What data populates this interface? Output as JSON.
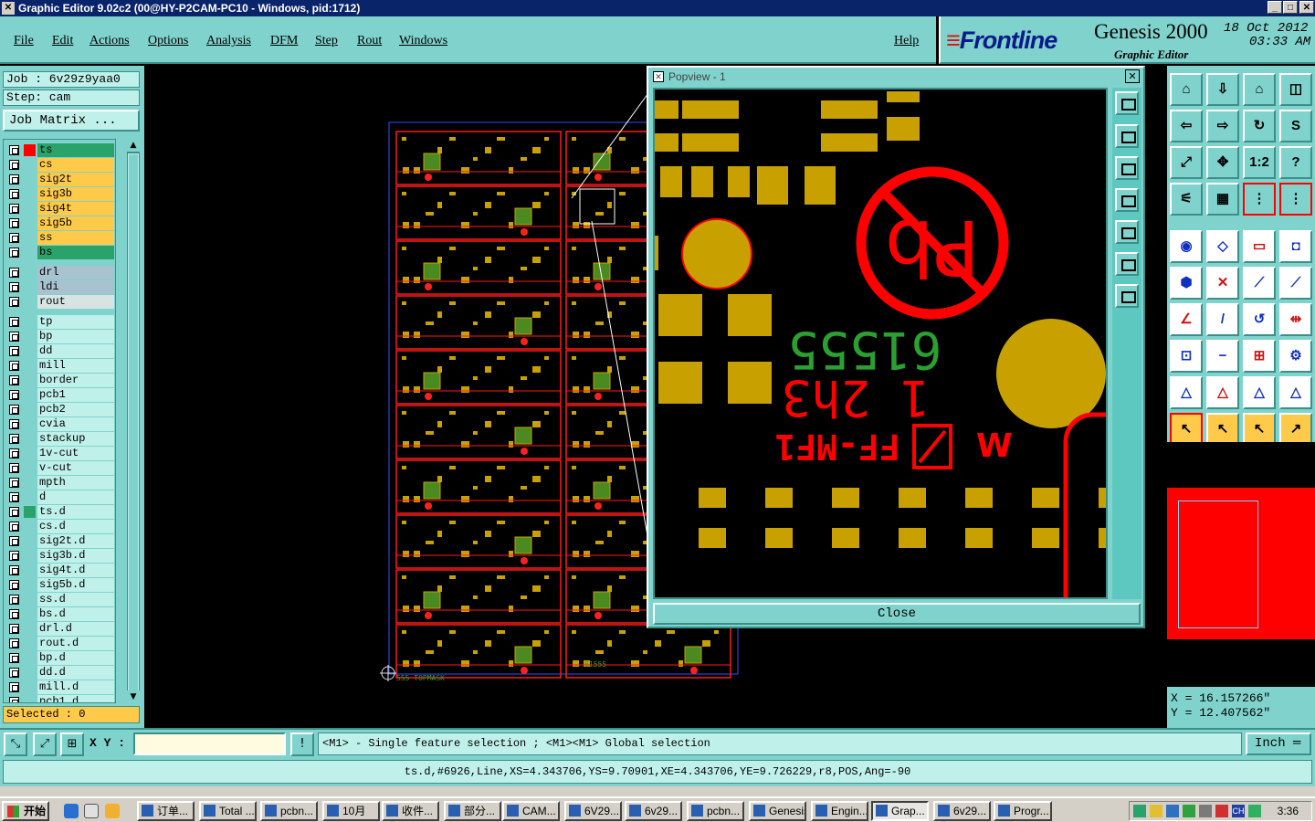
{
  "window": {
    "title": "Graphic Editor 9.02c2 (00@HY-P2CAM-PC10 - Windows, pid:1712)",
    "min": "_",
    "max": "□",
    "close": "✕"
  },
  "menu": [
    "File",
    "Edit",
    "Actions",
    "Options",
    "Analysis",
    "DFM",
    "Step",
    "Rout",
    "Windows"
  ],
  "help": "Help",
  "brand": {
    "logo": "Frontline",
    "product": "Genesis 2000",
    "subtitle": "Graphic Editor",
    "date": "18 Oct 2012",
    "time": "03:33 AM"
  },
  "job": {
    "job_line": "Job : 6v29z9yaa0",
    "step_line": "Step: cam",
    "matrix_button": "Job Matrix ..."
  },
  "layers": [
    {
      "name": "ts",
      "color": "#2aa36a",
      "marker": "#ff0000"
    },
    {
      "name": "cs",
      "color": "#ffc94a"
    },
    {
      "name": "sig2t",
      "color": "#ffc94a"
    },
    {
      "name": "sig3b",
      "color": "#ffc94a"
    },
    {
      "name": "sig4t",
      "color": "#ffc94a"
    },
    {
      "name": "sig5b",
      "color": "#ffc94a"
    },
    {
      "name": "ss",
      "color": "#ffc94a"
    },
    {
      "name": "bs",
      "color": "#2aa36a"
    },
    {
      "name": "drl",
      "color": "#a9c2cf"
    },
    {
      "name": "ldi",
      "color": "#a9c2cf"
    },
    {
      "name": "rout",
      "color": "#d8e4e4"
    },
    {
      "name": "tp",
      "color": "#bff0ea"
    },
    {
      "name": "bp",
      "color": "#bff0ea"
    },
    {
      "name": "dd",
      "color": "#bff0ea"
    },
    {
      "name": "mill",
      "color": "#bff0ea"
    },
    {
      "name": "border",
      "color": "#bff0ea"
    },
    {
      "name": "pcb1",
      "color": "#bff0ea"
    },
    {
      "name": "pcb2",
      "color": "#bff0ea"
    },
    {
      "name": "cvia",
      "color": "#bff0ea"
    },
    {
      "name": "stackup",
      "color": "#bff0ea"
    },
    {
      "name": "1v-cut",
      "color": "#bff0ea"
    },
    {
      "name": "v-cut",
      "color": "#bff0ea"
    },
    {
      "name": "mpth",
      "color": "#bff0ea"
    },
    {
      "name": "d",
      "color": "#bff0ea"
    },
    {
      "name": "ts.d",
      "color": "#bff0ea",
      "marker": "#2aa36a"
    },
    {
      "name": "cs.d",
      "color": "#bff0ea"
    },
    {
      "name": "sig2t.d",
      "color": "#bff0ea"
    },
    {
      "name": "sig3b.d",
      "color": "#bff0ea"
    },
    {
      "name": "sig4t.d",
      "color": "#bff0ea"
    },
    {
      "name": "sig5b.d",
      "color": "#bff0ea"
    },
    {
      "name": "ss.d",
      "color": "#bff0ea"
    },
    {
      "name": "bs.d",
      "color": "#bff0ea"
    },
    {
      "name": "drl.d",
      "color": "#bff0ea"
    },
    {
      "name": "rout.d",
      "color": "#bff0ea"
    },
    {
      "name": "bp.d",
      "color": "#bff0ea"
    },
    {
      "name": "dd.d",
      "color": "#bff0ea"
    },
    {
      "name": "mill.d",
      "color": "#bff0ea"
    },
    {
      "name": "pcb1.d",
      "color": "#bff0ea"
    }
  ],
  "selected": "Selected : 0",
  "canvas": {
    "board_label": "61555",
    "bottom_label": "555  TOPMASK"
  },
  "popview": {
    "title": "Popview - 1",
    "close_label": "Close",
    "close_x": "✕",
    "texts": {
      "green_number": "61555",
      "red_number": "1 2h3",
      "red_marking": "FF-MF1",
      "pb_symbol": "Pb"
    }
  },
  "coords": {
    "x": "X = 16.157266\"",
    "y": "Y = 12.407562\""
  },
  "command": {
    "xy_label": "X Y :",
    "xy_value": "",
    "hint": "<M1> - Single feature selection ; <M1><M1> Global selection",
    "unit": "Inch"
  },
  "info": "ts.d,#6926,Line,XS=4.343706,YS=9.70901,XE=4.343706,YE=9.726229,r8,POS,Ang=-90",
  "taskbar": {
    "start": "开始",
    "tasks": [
      "订单...",
      "Total ...",
      "pcbn...",
      "10月",
      "收件...",
      "部分...",
      "CAM...",
      "6V29...",
      "6v29...",
      "pcbn...",
      "Genesis",
      "Engin...",
      "Grap...",
      "6v29...",
      "Progr..."
    ],
    "clock": "3:36",
    "lang": "CH"
  },
  "colors": {
    "panel": "#7fd3cc",
    "panel_light": "#bff0ea",
    "copper": "#c8a000",
    "mask_red": "#ff0000",
    "silk_green": "#2aa030"
  },
  "icons": {
    "right_tools": [
      "view-home-icon",
      "view-down-icon",
      "house-icon",
      "window-split-icon",
      "view-left-icon",
      "view-right-icon",
      "swap-icon",
      "snap-icon",
      "fit-icon",
      "center-icon",
      "ratio-icon",
      "help-icon",
      "probe-icon",
      "grid-icon",
      "layer-red-icon",
      "layer-red2-icon",
      "select-point-icon",
      "select-poly-icon",
      "measure-icon",
      "circle-select-icon",
      "nodes-icon",
      "cross-icon",
      "line-dot-icon",
      "line-dot2-icon",
      "angle-icon",
      "slash-icon",
      "rotate-icon",
      "mirror-icon",
      "pad-icon",
      "minus-icon",
      "dim-icon",
      "rings-icon",
      "triangle-icon",
      "triangle2-icon",
      "triangle3-icon",
      "triangle4-icon",
      "cursor-icon",
      "cursor2-icon",
      "cursor3-icon",
      "route-icon"
    ]
  }
}
